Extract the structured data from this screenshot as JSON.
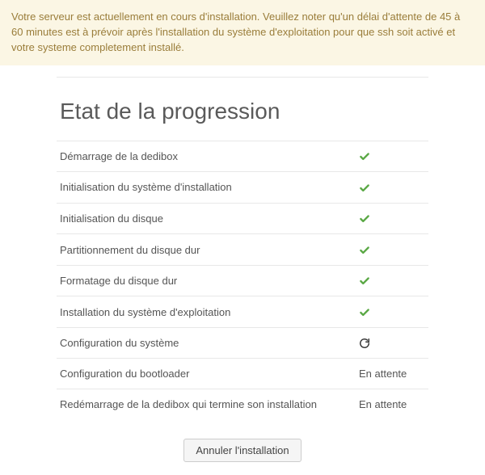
{
  "notice": "Votre serveur est actuellement en cours d'installation. Veuillez noter qu'un délai d'attente de 45 à 60 minutes est à prévoir après l'installation du système d'exploitation pour que ssh soit activé et votre systeme completement installé.",
  "title": "Etat de la progression",
  "steps": [
    {
      "label": "Démarrage de la dedibox",
      "status": "done"
    },
    {
      "label": "Initialisation du système d'installation",
      "status": "done"
    },
    {
      "label": "Initialisation du disque",
      "status": "done"
    },
    {
      "label": "Partitionnement du disque dur",
      "status": "done"
    },
    {
      "label": "Formatage du disque dur",
      "status": "done"
    },
    {
      "label": "Installation du système d'exploitation",
      "status": "done"
    },
    {
      "label": "Configuration du système",
      "status": "running"
    },
    {
      "label": "Configuration du bootloader",
      "status": "pending",
      "status_text": "En attente"
    },
    {
      "label": "Redémarrage de la dedibox qui termine son installation",
      "status": "pending",
      "status_text": "En attente"
    }
  ],
  "cancel_label": "Annuler l'installation"
}
